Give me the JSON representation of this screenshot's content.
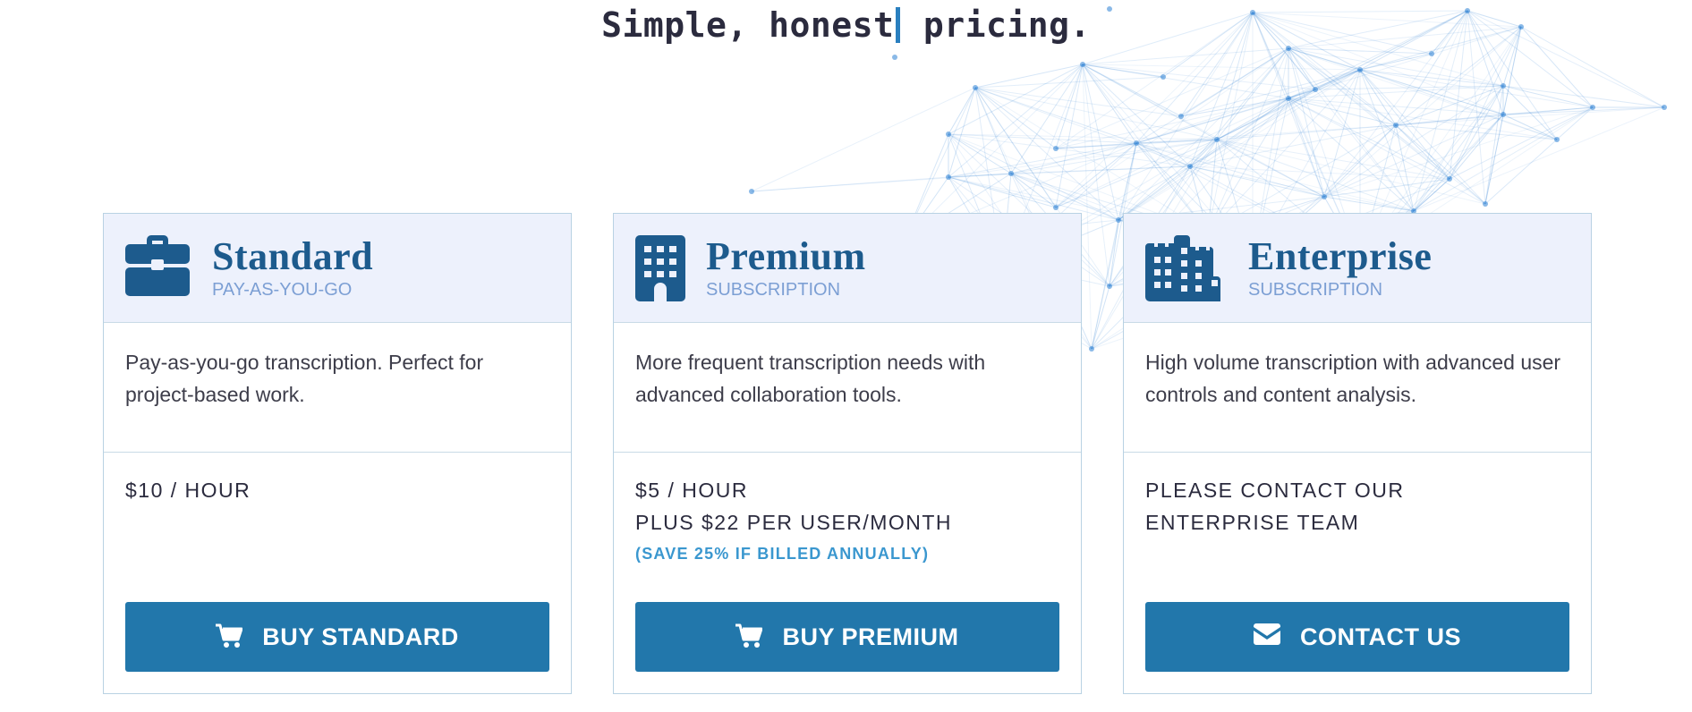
{
  "headline": {
    "before": "Simple, honest",
    "after": " pricing."
  },
  "plans": [
    {
      "name": "Standard",
      "type": "PAY-AS-YOU-GO",
      "icon": "briefcase-icon",
      "description": "Pay-as-you-go transcription. Perfect for project-based work.",
      "price_lines": [
        "$10 / HOUR"
      ],
      "note": "",
      "button": {
        "label": "BUY STANDARD",
        "icon": "cart-icon"
      }
    },
    {
      "name": "Premium",
      "type": "SUBSCRIPTION",
      "icon": "building-icon",
      "description": "More frequent transcription needs with advanced collaboration tools.",
      "price_lines": [
        "$5 / HOUR",
        "PLUS $22 PER USER/MONTH"
      ],
      "note": "(SAVE 25% IF BILLED ANNUALLY)",
      "button": {
        "label": "BUY PREMIUM",
        "icon": "cart-icon"
      }
    },
    {
      "name": "Enterprise",
      "type": "SUBSCRIPTION",
      "icon": "buildings-icon",
      "description": "High volume transcription with advanced user controls and content analysis.",
      "price_lines": [
        "PLEASE CONTACT OUR",
        "ENTERPRISE TEAM"
      ],
      "note": "",
      "button": {
        "label": "CONTACT US",
        "icon": "envelope-icon"
      }
    }
  ],
  "colors": {
    "brand_dark": "#1d5b8d",
    "subtitle": "#7c9fd4",
    "button": "#2277ab",
    "note": "#3a97cf",
    "header_bg": "#edf1fc",
    "network_lines": "#2a7fd4"
  }
}
